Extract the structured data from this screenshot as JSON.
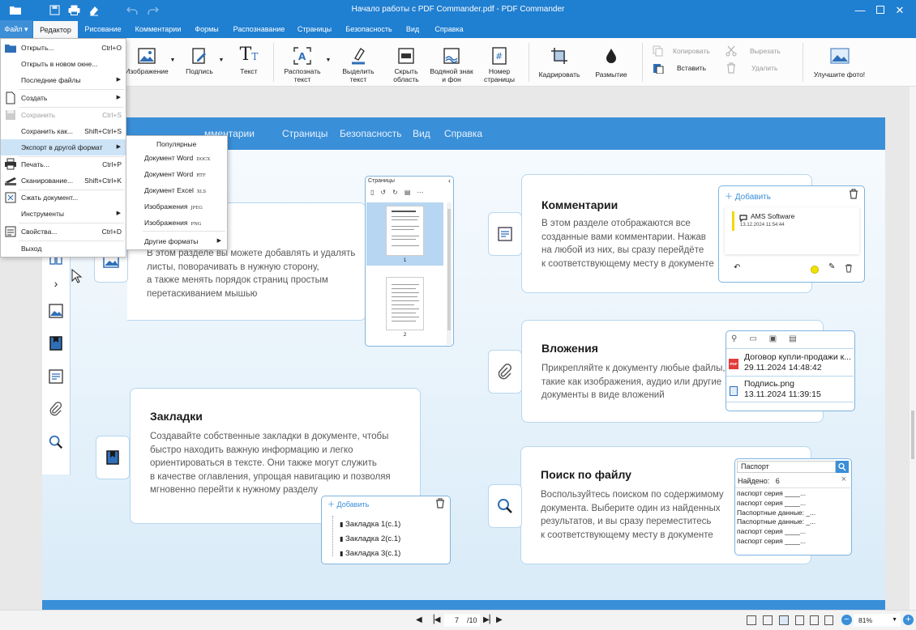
{
  "window": {
    "title": "Начало работы с PDF Commander.pdf - PDF Commander"
  },
  "menubar": {
    "tabs": [
      "Файл",
      "Редактор",
      "Рисование",
      "Комментарии",
      "Формы",
      "Распознавание",
      "Страницы",
      "Безопасность",
      "Вид",
      "Справка"
    ],
    "active": "Редактор"
  },
  "ribbon": {
    "image": "Изображение",
    "signature": "Подпись",
    "text": "Текст",
    "recognize": "Распознать текст",
    "highlight": "Выделить текст",
    "hide": "Скрыть область",
    "watermark": "Водяной знак и фон",
    "pagenum": "Номер страницы",
    "crop": "Кадрировать",
    "blur": "Размытие",
    "copy": "Копировать",
    "paste": "Вставить",
    "cut": "Вырезать",
    "delete": "Удалить",
    "enhance": "Улучшите фото!"
  },
  "filemenu": {
    "items": [
      {
        "label": "Открыть...",
        "shortcut": "Ctrl+O"
      },
      {
        "label": "Открыть в новом окне..."
      },
      {
        "label": "Последние файлы"
      },
      {
        "label": "Создать"
      },
      {
        "label": "Сохранить",
        "shortcut": "Ctrl+S"
      },
      {
        "label": "Сохранить как...",
        "shortcut": "Shift+Ctrl+S"
      },
      {
        "label": "Экспорт в другой формат"
      },
      {
        "label": "Печать...",
        "shortcut": "Ctrl+P"
      },
      {
        "label": "Сканирование...",
        "shortcut": "Shift+Ctrl+K"
      },
      {
        "label": "Сжать документ..."
      },
      {
        "label": "Инструменты"
      },
      {
        "label": "Свойства...",
        "shortcut": "Ctrl+D"
      },
      {
        "label": "Выход"
      }
    ]
  },
  "submenu": {
    "header": "Популярные",
    "items": [
      {
        "label": "Документ Word",
        "tag": "DOCX"
      },
      {
        "label": "Документ Word",
        "tag": "RTF"
      },
      {
        "label": "Документ Excel",
        "tag": "XLS"
      },
      {
        "label": "Изображения",
        "tag": "JPEG"
      },
      {
        "label": "Изображения",
        "tag": "PNG"
      }
    ],
    "other": "Другие форматы"
  },
  "page": {
    "nav": [
      "мментарии",
      "Страницы",
      "Безопасность",
      "Вид",
      "Справка"
    ],
    "pages_card": {
      "lines": [
        "В этом разделе вы можете добавлять и удалять",
        "листы, поворачивать в нужную сторону,",
        "а также менять порядок страниц простым",
        "перетаскиванием мышью"
      ]
    },
    "pages_panel": {
      "title": "Страницы",
      "thumbs": [
        "1",
        "2"
      ]
    },
    "comments_card": {
      "title": "Комментарии",
      "lines": [
        "В этом разделе отображаются все",
        "созданные вами комментарии. Нажав",
        "на любой из них, вы сразу перейдёте",
        "к соответствующему месту в документе"
      ]
    },
    "comments_panel": {
      "add": "Добавить",
      "author": "AMS Software",
      "date": "13.12.2024 11:54:44"
    },
    "attach_card": {
      "title": "Вложения",
      "lines": [
        "Прикрепляйте к документу любые файлы,",
        "такие как изображения, аудио или другие",
        "документы в виде вложений"
      ]
    },
    "attach_panel": {
      "files": [
        {
          "name": "Договор купли-продажи к...",
          "date": "29.11.2024 14:48:42"
        },
        {
          "name": "Подпись.png",
          "date": "13.11.2024 11:39:15"
        }
      ]
    },
    "bookmarks_card": {
      "title": "Закладки",
      "lines": [
        "Создавайте собственные закладки в документе, чтобы",
        "быстро находить важную информацию и легко",
        "ориентироваться в тексте. Они также могут служить",
        "в качестве оглавления, упрощая навигацию и позволяя",
        "мгновенно перейти к нужному разделу"
      ]
    },
    "bookmarks_panel": {
      "add": "Добавить",
      "items": [
        "Закладка 1(с.1)",
        "Закладка 2(с.1)",
        "Закладка 3(с.1)"
      ]
    },
    "search_card": {
      "title": "Поиск по файлу",
      "lines": [
        "Воспользуйтесь поиском по содержимому",
        "документа. Выберите один из найденных",
        "результатов, и вы сразу переместитесь",
        "к соответствующему месту в документе"
      ]
    },
    "search_panel": {
      "query": "Паспорт",
      "found_label": "Найдено:",
      "found_count": "6",
      "results": [
        "паспорт серия ____...",
        "паспорт серия ____...",
        "Паспортные данные: _...",
        "Паспортные данные: _...",
        "паспорт серия ____...",
        "паспорт серия ____..."
      ]
    }
  },
  "status": {
    "page": "7",
    "total": "/10",
    "zoom": "81%"
  },
  "colors": {
    "accent": "#1f7fd1",
    "panel_border": "#7fb4de",
    "highlight": "#cde4f7"
  }
}
